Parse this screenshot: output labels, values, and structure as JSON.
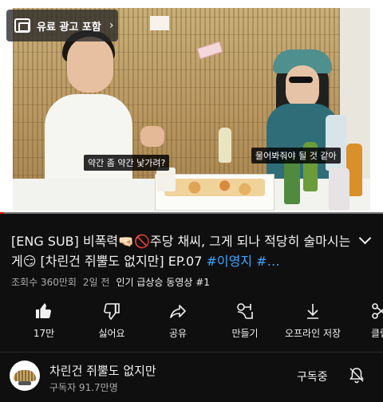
{
  "ad_badge": {
    "label": "유료 광고 포함"
  },
  "subtitles": {
    "left": "약간 좀 약간 낯가려?",
    "right": "물어봐줘야 될 것 같아"
  },
  "progress": {
    "fraction": 0.01
  },
  "video_info": {
    "title": "[ENG SUB] 비폭력🤜🏻🚫주당 채씨, 그게 되나 적당히 술마시는 게😏  [차린건 쥐뿔도 없지만] EP.07 ",
    "title_tag": "#이영지 #…",
    "views": "조회수 360만회",
    "age": "2일 전",
    "trending": "인기 급상승 동영상 #1"
  },
  "actions": [
    {
      "name": "like",
      "icon": "thumbs-up-icon",
      "label": "17만"
    },
    {
      "name": "dislike",
      "icon": "thumbs-down-icon",
      "label": "싫어요"
    },
    {
      "name": "share",
      "icon": "share-icon",
      "label": "공유"
    },
    {
      "name": "remix",
      "icon": "remix-icon",
      "label": "만들기"
    },
    {
      "name": "download",
      "icon": "download-icon",
      "label": "오프라인 저장"
    },
    {
      "name": "clip",
      "icon": "scissors-icon",
      "label": "클립"
    }
  ],
  "channel": {
    "name": "차린건 쥐뿔도 없지만",
    "subscribers": "구독자 91.7만명",
    "subscribed_label": "구독중"
  },
  "colors": {
    "accent": "#3ea6ff",
    "progress": "#ff0000",
    "background": "#0f0f0f"
  }
}
